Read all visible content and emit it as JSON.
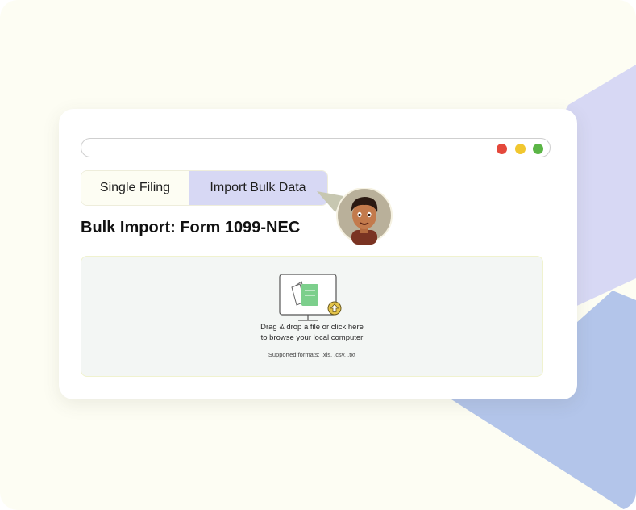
{
  "window": {
    "controls": [
      "close",
      "minimize",
      "maximize"
    ],
    "colors": {
      "close": "#e4483b",
      "minimize": "#f1c72f",
      "maximize": "#5bb546"
    }
  },
  "tabs": [
    {
      "label": "Single Filing",
      "active": false
    },
    {
      "label": "Import Bulk Data",
      "active": true
    }
  ],
  "page": {
    "title": "Bulk Import: Form 1099-NEC"
  },
  "dropzone": {
    "line1": "Drag & drop a file or click here",
    "line2": "to browse your local computer",
    "formats": "Supported formats: .xls, .csv, .txt",
    "icon": "upload-file-icon"
  },
  "assistant": {
    "icon": "avatar"
  },
  "theme": {
    "background": "#fdfdf3",
    "accent_lavender": "#d7d8f4",
    "accent_blue": "#b3c5ea",
    "dropzone_bg": "#f3f6f4"
  }
}
